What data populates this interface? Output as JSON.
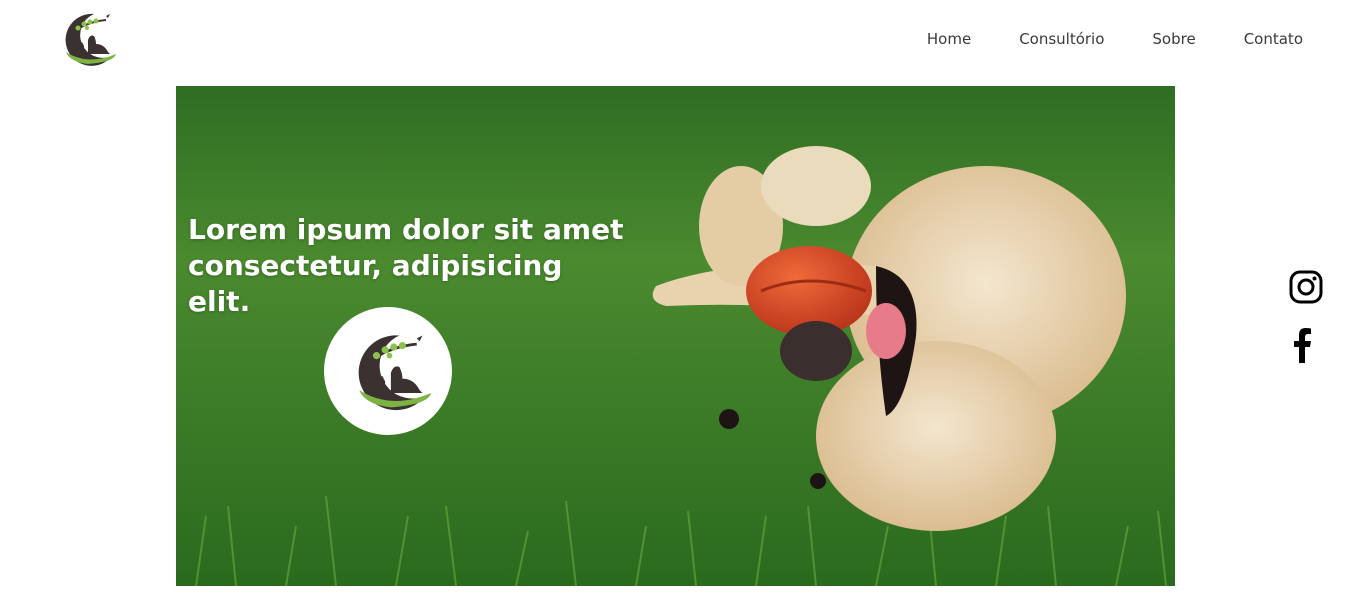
{
  "header": {
    "logo_icon": "pet-clinic-logo",
    "nav": [
      {
        "label": "Home"
      },
      {
        "label": "Consultório"
      },
      {
        "label": "Sobre"
      },
      {
        "label": "Contato"
      }
    ]
  },
  "hero": {
    "title": "Lorem ipsum dolor sit amet consectetur, adipisicing elit.",
    "image": "golden-retriever-playing-with-ball-on-grass",
    "badge_icon": "pet-clinic-logo"
  },
  "social": [
    {
      "icon": "instagram-icon"
    },
    {
      "icon": "facebook-icon"
    }
  ],
  "colors": {
    "nav_text": "#3a3a3a",
    "logo_dark": "#3b3131",
    "logo_green": "#7cb342",
    "grass": "#3d7a2a",
    "ball": "#d9441e"
  }
}
